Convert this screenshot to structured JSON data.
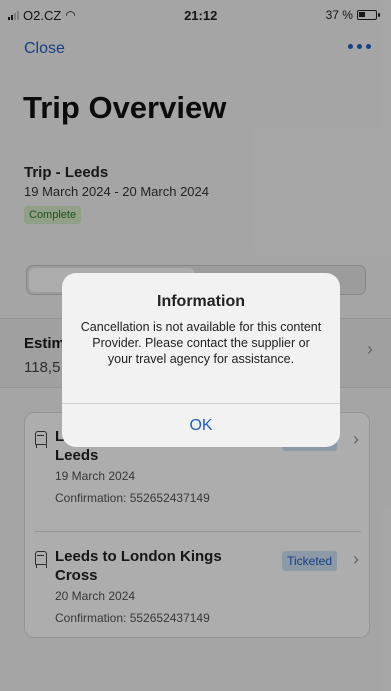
{
  "status_bar": {
    "carrier": "O2.CZ",
    "time": "21:12",
    "battery": "37 %"
  },
  "nav": {
    "close_label": "Close"
  },
  "page_title": "Trip Overview",
  "trip": {
    "name": "Trip - Leeds",
    "dates": "19 March 2024 - 20 March 2024",
    "status": "Complete"
  },
  "estimate": {
    "label": "Estim",
    "value": "118,5"
  },
  "bookings": [
    {
      "title": "London Kings Cross to Leeds",
      "date": "19 March 2024",
      "confirmation": "Confirmation: 552652437149",
      "status": "Ticketed"
    },
    {
      "title": "Leeds to London Kings Cross",
      "date": "20 March 2024",
      "confirmation": "Confirmation: 552652437149",
      "status": "Ticketed"
    }
  ],
  "alert": {
    "title": "Information",
    "message": "Cancellation is not available for this content Provider. Please contact the supplier or your travel agency for assistance.",
    "ok_label": "OK"
  },
  "colors": {
    "accent": "#2060c0",
    "complete_badge_bg": "#d8ecc8",
    "ticketed_badge_bg": "#d0e2f6"
  }
}
